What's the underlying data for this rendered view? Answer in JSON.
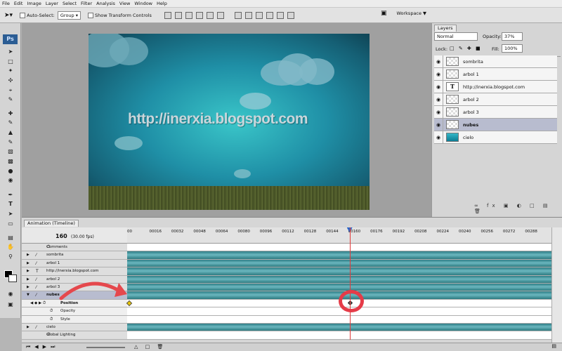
{
  "menubar": [
    "File",
    "Edit",
    "Image",
    "Layer",
    "Select",
    "Filter",
    "Analysis",
    "View",
    "Window",
    "Help"
  ],
  "options": {
    "auto_select": "Auto-Select:",
    "auto_select_value": "Group",
    "show_transform": "Show Transform Controls",
    "workspace": "Workspace"
  },
  "toolbox": {
    "logo": "Ps"
  },
  "canvas": {
    "url_text": "http://inerxia.blogspot.com"
  },
  "layers_panel": {
    "tab": "Layers",
    "blend_mode": "Normal",
    "opacity_label": "Opacity:",
    "opacity_value": "37%",
    "lock_label": "Lock:",
    "fill_label": "Fill:",
    "fill_value": "100%",
    "layers": [
      {
        "name": "sombrita",
        "thumb": "checker",
        "selected": false
      },
      {
        "name": "arbol 1",
        "thumb": "checker",
        "selected": false
      },
      {
        "name": "http://inerxia.blogspot.com",
        "thumb": "text",
        "selected": false
      },
      {
        "name": "arbol 2",
        "thumb": "checker",
        "selected": false
      },
      {
        "name": "arbol 3",
        "thumb": "checker",
        "selected": false
      },
      {
        "name": "nubes",
        "thumb": "checker",
        "selected": true
      },
      {
        "name": "cielo",
        "thumb": "cyan",
        "selected": false
      }
    ]
  },
  "animation": {
    "tab": "Animation (Timeline)",
    "current_time": "160",
    "fps": "(30.00 fps)",
    "ruler": [
      "00",
      "00016",
      "00032",
      "00048",
      "00064",
      "00080",
      "00096",
      "00112",
      "00128",
      "00144",
      "00160",
      "00176",
      "00192",
      "00208",
      "00224",
      "00240",
      "00256",
      "00272",
      "00288"
    ],
    "ruler_max": 300,
    "playhead_frame": 160,
    "tracks": [
      {
        "name": "Comments",
        "kind": "comments",
        "bar": false
      },
      {
        "name": "sombrita",
        "kind": "layer",
        "bar": true
      },
      {
        "name": "arbol 1",
        "kind": "layer",
        "bar": true
      },
      {
        "name": "http://inerxia.blogspot.com",
        "kind": "text",
        "bar": true
      },
      {
        "name": "arbol 2",
        "kind": "layer",
        "bar": true
      },
      {
        "name": "arbol 3",
        "kind": "layer",
        "bar": true
      },
      {
        "name": "nubes",
        "kind": "layer-open",
        "bar": true,
        "selected": true
      },
      {
        "name": "Position",
        "kind": "property-selected",
        "bar": false,
        "keyframes": [
          0,
          160
        ]
      },
      {
        "name": "Opacity",
        "kind": "property",
        "bar": false
      },
      {
        "name": "Style",
        "kind": "property",
        "bar": false
      },
      {
        "name": "cielo",
        "kind": "layer",
        "bar": true
      },
      {
        "name": "Global Lighting",
        "kind": "global",
        "bar": false
      }
    ]
  }
}
